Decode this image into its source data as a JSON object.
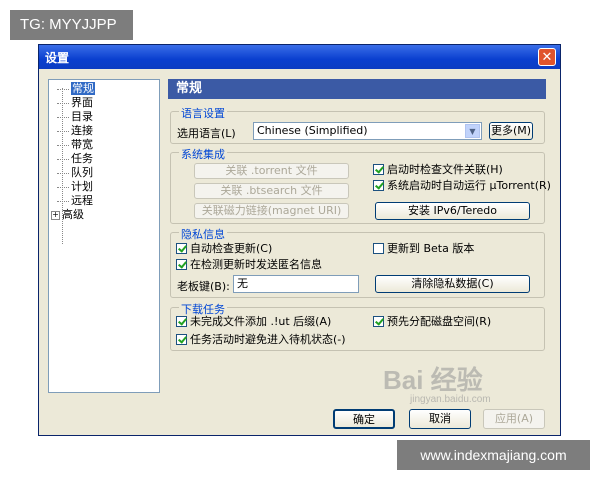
{
  "overlay": {
    "tag": "TG: MYYJJPP",
    "url": "www.indexmajiang.com"
  },
  "window": {
    "title": "设置",
    "close_glyph": "✕"
  },
  "tree": {
    "items": [
      {
        "label": "常规",
        "selected": true
      },
      {
        "label": "界面"
      },
      {
        "label": "目录"
      },
      {
        "label": "连接"
      },
      {
        "label": "带宽"
      },
      {
        "label": "任务"
      },
      {
        "label": "队列"
      },
      {
        "label": "计划"
      },
      {
        "label": "远程"
      },
      {
        "label": "高级",
        "expandable": true,
        "expander": "+"
      }
    ]
  },
  "panel": {
    "title": "常规",
    "language": {
      "group_label": "语言设置",
      "select_label": "选用语言(L)",
      "selected_value": "Chinese (Simplified)",
      "more_button": "更多(M)"
    },
    "integration": {
      "group_label": "系统集成",
      "assoc_torrent": "关联 .torrent 文件",
      "assoc_btsearch": "关联 .btsearch 文件",
      "assoc_magnet": "关联磁力链接(magnet URI)",
      "check_assoc": "启动时检查文件关联(H)",
      "autostart": "系统启动时自动运行 µTorrent(R)",
      "ipv6_button": "安装 IPv6/Teredo"
    },
    "privacy": {
      "group_label": "隐私信息",
      "auto_check_update": "自动检查更新(C)",
      "beta_update": "更新到 Beta 版本",
      "anonymous_info": "在检测更新时发送匿名信息",
      "boss_key_label": "老板键(B):",
      "boss_key_value": "无",
      "clear_button": "清除隐私数据(C)"
    },
    "download": {
      "group_label": "下载任务",
      "append_ut": "未完成文件添加 .!ut 后缀(A)",
      "prealloc": "预先分配磁盘空间(R)",
      "prevent_standby": "任务活动时避免进入待机状态(-)"
    }
  },
  "footer": {
    "ok": "确定",
    "cancel": "取消",
    "apply": "应用(A)"
  },
  "watermark": {
    "main": "Bai 经验",
    "sub": "jingyan.baidu.com"
  }
}
